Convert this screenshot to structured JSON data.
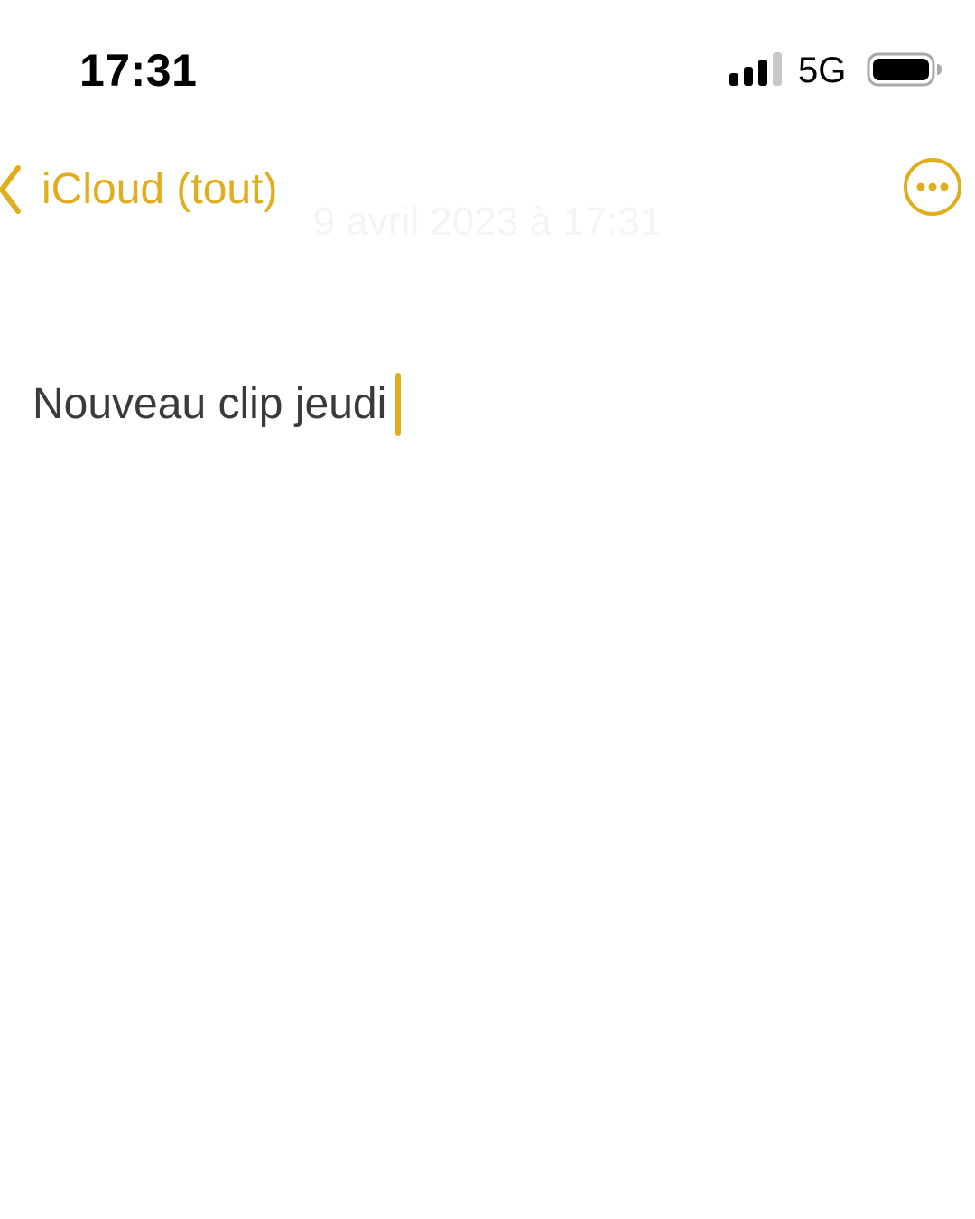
{
  "status_bar": {
    "time": "17:31",
    "network": "5G",
    "signal_bars_active": 3,
    "signal_bars_total": 4,
    "signal_icon": "cellular-signal-icon",
    "battery_icon": "battery-icon"
  },
  "nav": {
    "back_label": "iCloud (tout)",
    "back_icon": "chevron-left-icon",
    "date": "9 avril 2023 à 17:31",
    "more_icon": "ellipsis-circle-icon"
  },
  "note": {
    "text": "Nouveau clip jeudi"
  },
  "colors": {
    "accent": "#E0AE1C",
    "text": "#3a3a3c",
    "background": "#ffffff"
  }
}
